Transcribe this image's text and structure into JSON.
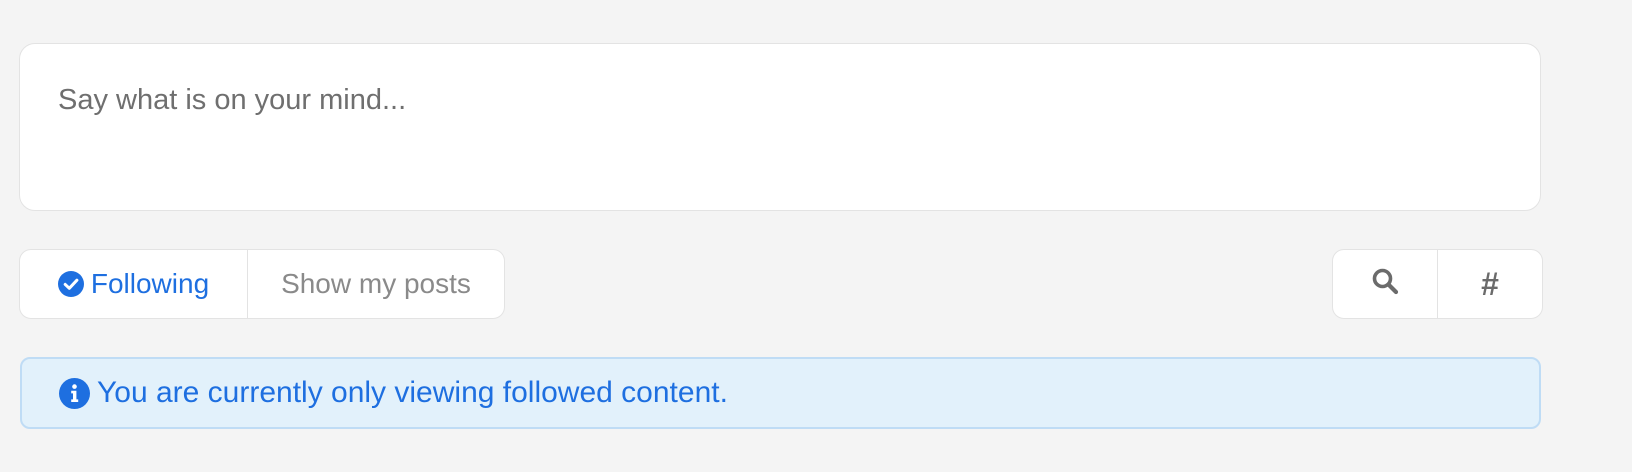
{
  "composer": {
    "placeholder": "Say what is on your mind..."
  },
  "filters": {
    "following_label": "Following",
    "my_posts_label": "Show my posts"
  },
  "tools": {
    "hashtag_symbol": "#",
    "search_icon": "search-icon"
  },
  "notice": {
    "text": "You are currently only viewing followed content.",
    "icon": "info-circle-icon"
  },
  "colors": {
    "accent": "#1e6fe0",
    "notice_bg": "#e2f1fb",
    "notice_border": "#bfdcf5",
    "page_bg": "#f4f4f4",
    "muted_text": "#8a8a8a"
  }
}
